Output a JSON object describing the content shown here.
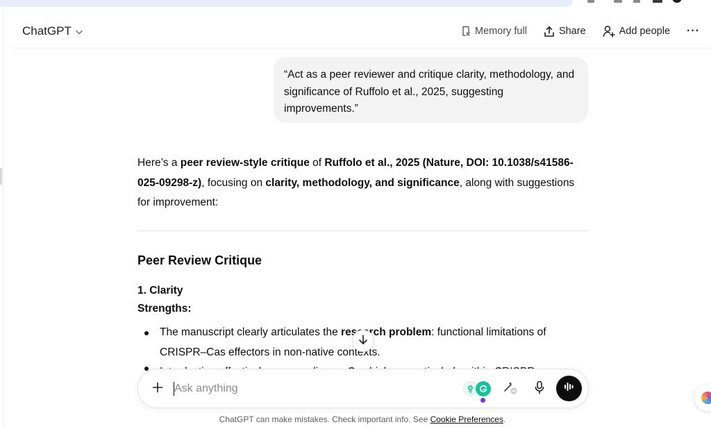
{
  "header": {
    "model_label": "ChatGPT",
    "memory_label": "Memory full",
    "share_label": "Share",
    "add_people_label": "Add people",
    "more_label": "···"
  },
  "conversation": {
    "user_message": "“Act as a peer reviewer and critique clarity, methodology, and significance of Ruffolo et al., 2025, suggesting improvements.”",
    "assistant_intro": {
      "t1": "Here’s a ",
      "b1": "peer review-style critique",
      "t2": " of ",
      "b2": "Ruffolo et al., 2025 (Nature, DOI: 10.1038/s41586-025-09298-z)",
      "t3": ", focusing on ",
      "b3": "clarity, methodology, and significance",
      "t4": ", along with suggestions for improvement:"
    },
    "section_title": "Peer Review Critique",
    "subsection_title": "1. Clarity",
    "strengths_label": "Strengths:",
    "bullet_1": {
      "t1": "The manuscript clearly articulates the ",
      "b1": "research problem",
      "t2": ": functional limitations of CRISPR–Cas effectors in non-native contexts."
    },
    "bullet_2_partial": "Introduction effectively surveys diverse Cas biology, particularly within CRISPR"
  },
  "composer": {
    "placeholder": "Ask anything",
    "value": "",
    "plus_label": "+"
  },
  "footer": {
    "note": "ChatGPT can make mistakes. Check important info. See ",
    "link": "Cookie Preferences",
    "end": "."
  },
  "colors": {
    "user_bubble": "#f3f3f3",
    "voice_button": "#0d0d0d",
    "grammarly": "#15c39a",
    "accent_dot": "#6c3ce0"
  },
  "icons": [
    "memory-icon",
    "share-icon",
    "add-people-icon",
    "more-icon",
    "plus-icon",
    "scroll-down-icon",
    "grammarly-icon",
    "magic-edit-icon",
    "mic-icon",
    "voice-mode-icon",
    "chevron-down-icon"
  ]
}
